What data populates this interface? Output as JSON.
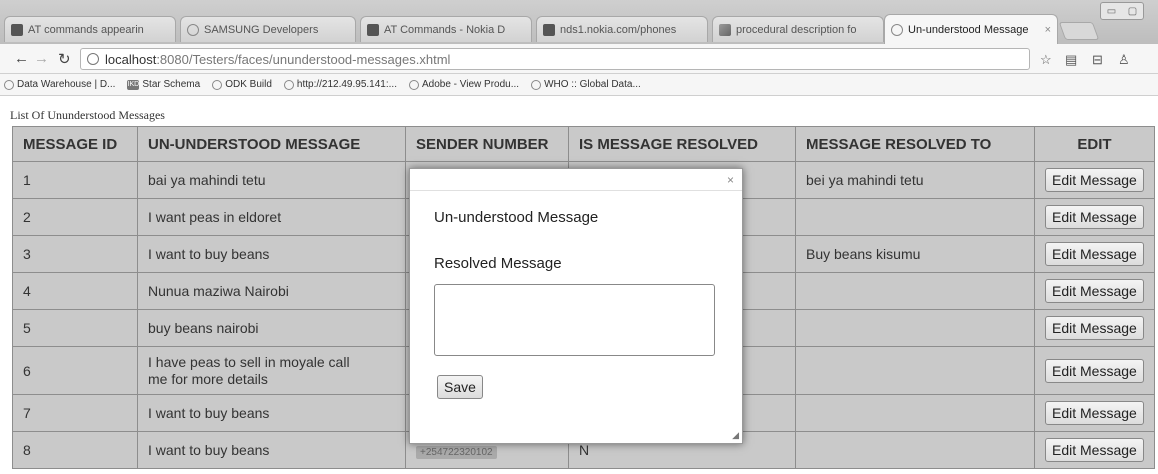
{
  "browser": {
    "tabs": [
      {
        "label": "AT commands appearin",
        "icon": "dark"
      },
      {
        "label": "SAMSUNG Developers",
        "icon": "circ"
      },
      {
        "label": "AT Commands - Nokia D",
        "icon": "dark"
      },
      {
        "label": "nds1.nokia.com/phones",
        "icon": "dark"
      },
      {
        "label": "procedural description fo",
        "icon": "pic"
      },
      {
        "label": "Un-understood Message",
        "icon": "circ",
        "active": true
      }
    ],
    "url_host": "localhost",
    "url_path": ":8080/Testers/faces/ununderstood-messages.xhtml",
    "bookmarks": [
      {
        "label": "Data Warehouse | D...",
        "icon": "circ"
      },
      {
        "label": "Star Schema",
        "icon": "sq",
        "badge": "IKD"
      },
      {
        "label": "ODK Build",
        "icon": "circ"
      },
      {
        "label": "http://212.49.95.141:...",
        "icon": "circ"
      },
      {
        "label": "Adobe - View Produ...",
        "icon": "circ"
      },
      {
        "label": "WHO :: Global Data...",
        "icon": "circ"
      }
    ]
  },
  "page": {
    "caption": "List Of Ununderstood Messages",
    "columns": [
      "MESSAGE ID",
      "UN-UNDERSTOOD MESSAGE",
      "SENDER NUMBER",
      "IS MESSAGE RESOLVED",
      "MESSAGE RESOLVED TO",
      "EDIT"
    ],
    "rows": [
      {
        "id": "1",
        "message": "bai ya mahindi tetu",
        "sender": "",
        "resolved": "",
        "resolved_to": "bei ya mahindi tetu",
        "edit": "Edit Message"
      },
      {
        "id": "2",
        "message": "I want peas in eldoret",
        "sender": "",
        "resolved": "",
        "resolved_to": "",
        "edit": "Edit Message"
      },
      {
        "id": "3",
        "message": "I want to buy beans",
        "sender": "",
        "resolved": "",
        "resolved_to": "Buy beans kisumu",
        "edit": "Edit Message"
      },
      {
        "id": "4",
        "message": "Nunua maziwa Nairobi",
        "sender": "",
        "resolved": "",
        "resolved_to": "",
        "edit": "Edit Message"
      },
      {
        "id": "5",
        "message": "buy beans nairobi",
        "sender": "",
        "resolved": "",
        "resolved_to": "",
        "edit": "Edit Message"
      },
      {
        "id": "6",
        "message": "I have peas to sell in moyale call me for more details",
        "sender": "",
        "resolved": "",
        "resolved_to": "",
        "edit": "Edit Message",
        "tall": true
      },
      {
        "id": "7",
        "message": "I want to buy beans",
        "sender": "",
        "resolved": "",
        "resolved_to": "",
        "edit": "Edit Message"
      },
      {
        "id": "8",
        "message": "I want to buy beans",
        "sender": "+254722320102",
        "resolved": "N",
        "resolved_to": "",
        "edit": "Edit Message"
      }
    ]
  },
  "dialog": {
    "close": "×",
    "label_unclear": "Un-understood Message",
    "label_resolved": "Resolved Message",
    "resolved_value": "",
    "save_label": "Save"
  }
}
